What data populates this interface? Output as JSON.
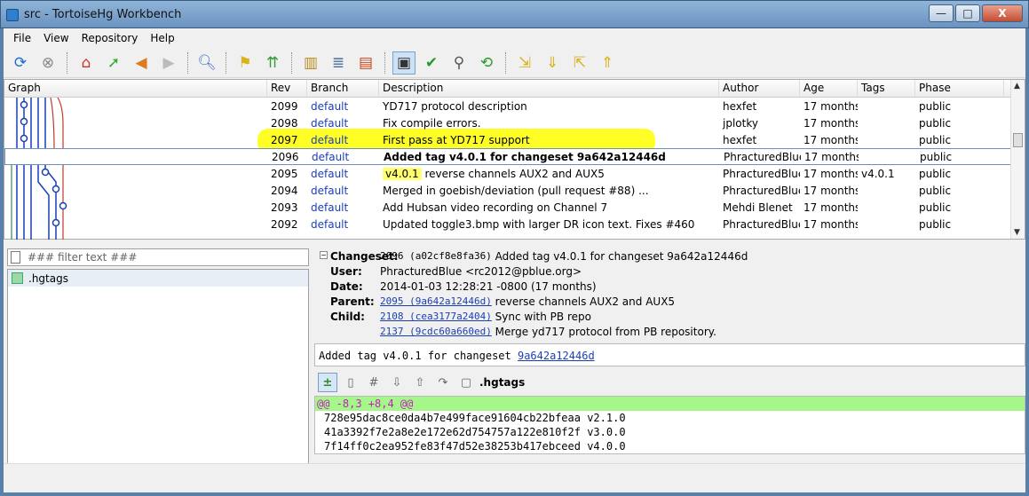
{
  "window": {
    "title": "src - TortoiseHg Workbench",
    "controls": {
      "minimize": "—",
      "maximize": "□",
      "close": "X"
    }
  },
  "menu": [
    "File",
    "View",
    "Repository",
    "Help"
  ],
  "log": {
    "columns": [
      "Graph",
      "Rev",
      "Branch",
      "Description",
      "Author",
      "Age",
      "Tags",
      "Phase"
    ],
    "rows": [
      {
        "rev": "2099",
        "branch": "default",
        "desc": "YD717 protocol description",
        "tag": "",
        "author": "hexfet",
        "age": "17 months",
        "tags": "",
        "phase": "public"
      },
      {
        "rev": "2098",
        "branch": "default",
        "desc": "Fix compile errors.",
        "tag": "",
        "author": "jplotky",
        "age": "17 months",
        "tags": "",
        "phase": "public"
      },
      {
        "rev": "2097",
        "branch": "default",
        "desc": "First pass at YD717 support",
        "tag": "",
        "author": "hexfet",
        "age": "17 months",
        "tags": "",
        "phase": "public"
      },
      {
        "rev": "2096",
        "branch": "default",
        "desc": "Added tag v4.0.1 for changeset 9a642a12446d",
        "tag": "",
        "author": "PhracturedBlue",
        "age": "17 months",
        "tags": "",
        "phase": "public"
      },
      {
        "rev": "2095",
        "branch": "default",
        "desc": "reverse channels AUX2 and AUX5",
        "tag": "v4.0.1",
        "author": "PhracturedBlue",
        "age": "17 months",
        "tags": "v4.0.1",
        "phase": "public"
      },
      {
        "rev": "2094",
        "branch": "default",
        "desc": "Merged in goebish/deviation (pull request #88) ...",
        "tag": "",
        "author": "PhracturedBlue",
        "age": "17 months",
        "tags": "",
        "phase": "public"
      },
      {
        "rev": "2093",
        "branch": "default",
        "desc": "Add Hubsan video recording on Channel 7",
        "tag": "",
        "author": "Mehdi Blenet",
        "age": "17 months",
        "tags": "",
        "phase": "public"
      },
      {
        "rev": "2092",
        "branch": "default",
        "desc": "Updated toggle3.bmp with larger DR icon text.  Fixes #460",
        "tag": "",
        "author": "PhracturedBlue",
        "age": "17 months",
        "tags": "",
        "phase": "public"
      }
    ]
  },
  "filter": {
    "placeholder": "### filter text ###"
  },
  "files": [
    ".hgtags"
  ],
  "changeset": {
    "changeset_label": "Changeset:",
    "changeset_id": "2096 (a02cf8e8fa36)",
    "changeset_desc": "Added tag v4.0.1 for changeset 9a642a12446d",
    "user_label": "User:",
    "user": "PhracturedBlue <rc2012@pblue.org>",
    "date_label": "Date:",
    "date": "2014-01-03 12:28:21 -0800 (17 months)",
    "parent_label": "Parent:",
    "parent_link": "2095 (9a642a12446d)",
    "parent_desc": "reverse channels AUX2 and AUX5",
    "child_label": "Child:",
    "children": [
      {
        "link": "2108 (cea3177a2404)",
        "desc": "Sync with PB repo"
      },
      {
        "link": "2137 (9cdc60a660ed)",
        "desc": "Merge yd717 protocol from PB repository."
      }
    ]
  },
  "message": {
    "text": "Added tag v4.0.1 for changeset ",
    "link": "9a642a12446d"
  },
  "diff": {
    "file": ".hgtags",
    "hunk": "@@ -8,3 +8,4 @@",
    "lines": [
      "728e95dac8ce0da4b7e499face91604cb22bfeaa v2.1.0",
      "41a3392f7e2a8e2e172e62d754757a122e810f2f v3.0.0",
      "7f14ff0c2ea952fe83f47d52e38253b417ebceed v4.0.0"
    ]
  }
}
